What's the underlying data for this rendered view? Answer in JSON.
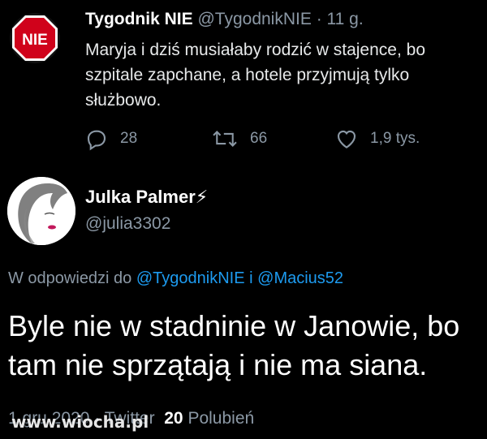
{
  "tweet": {
    "author_name": "Tygodnik NIE",
    "author_handle": "@TygodnikNIE",
    "separator": "·",
    "time": "11 g.",
    "avatar_text": "NIE",
    "text": "Maryja i dziś musiałaby rodzić w stajence, bo szpitale zapchane, a hotele przyjmują tylko służbowo.",
    "actions": {
      "reply_count": "28",
      "retweet_count": "66",
      "like_count": "1,9 tys."
    }
  },
  "reply": {
    "author_name": "Julka Palmer⚡",
    "author_handle": "@julia3302",
    "reply_prefix": "W odpowiedzi do",
    "reply_target_1": "@TygodnikNIE",
    "reply_joiner": "i",
    "reply_target_2": "@Macius52",
    "text": "Byle nie w stadninie w Janowie, bo tam nie sprzątają i nie ma siana.",
    "date": "1 gru 2020",
    "source": "Twitter",
    "likes_count": "20",
    "likes_label": "Polubień"
  },
  "watermark": "www.wiocha.pl",
  "colors": {
    "background": "#000000",
    "link": "#1d9bf0",
    "muted": "#8b98a5",
    "stop_sign": "#d0021b"
  },
  "icons": [
    "reply-icon",
    "retweet-icon",
    "like-icon",
    "stop-sign-avatar",
    "profile-avatar"
  ]
}
